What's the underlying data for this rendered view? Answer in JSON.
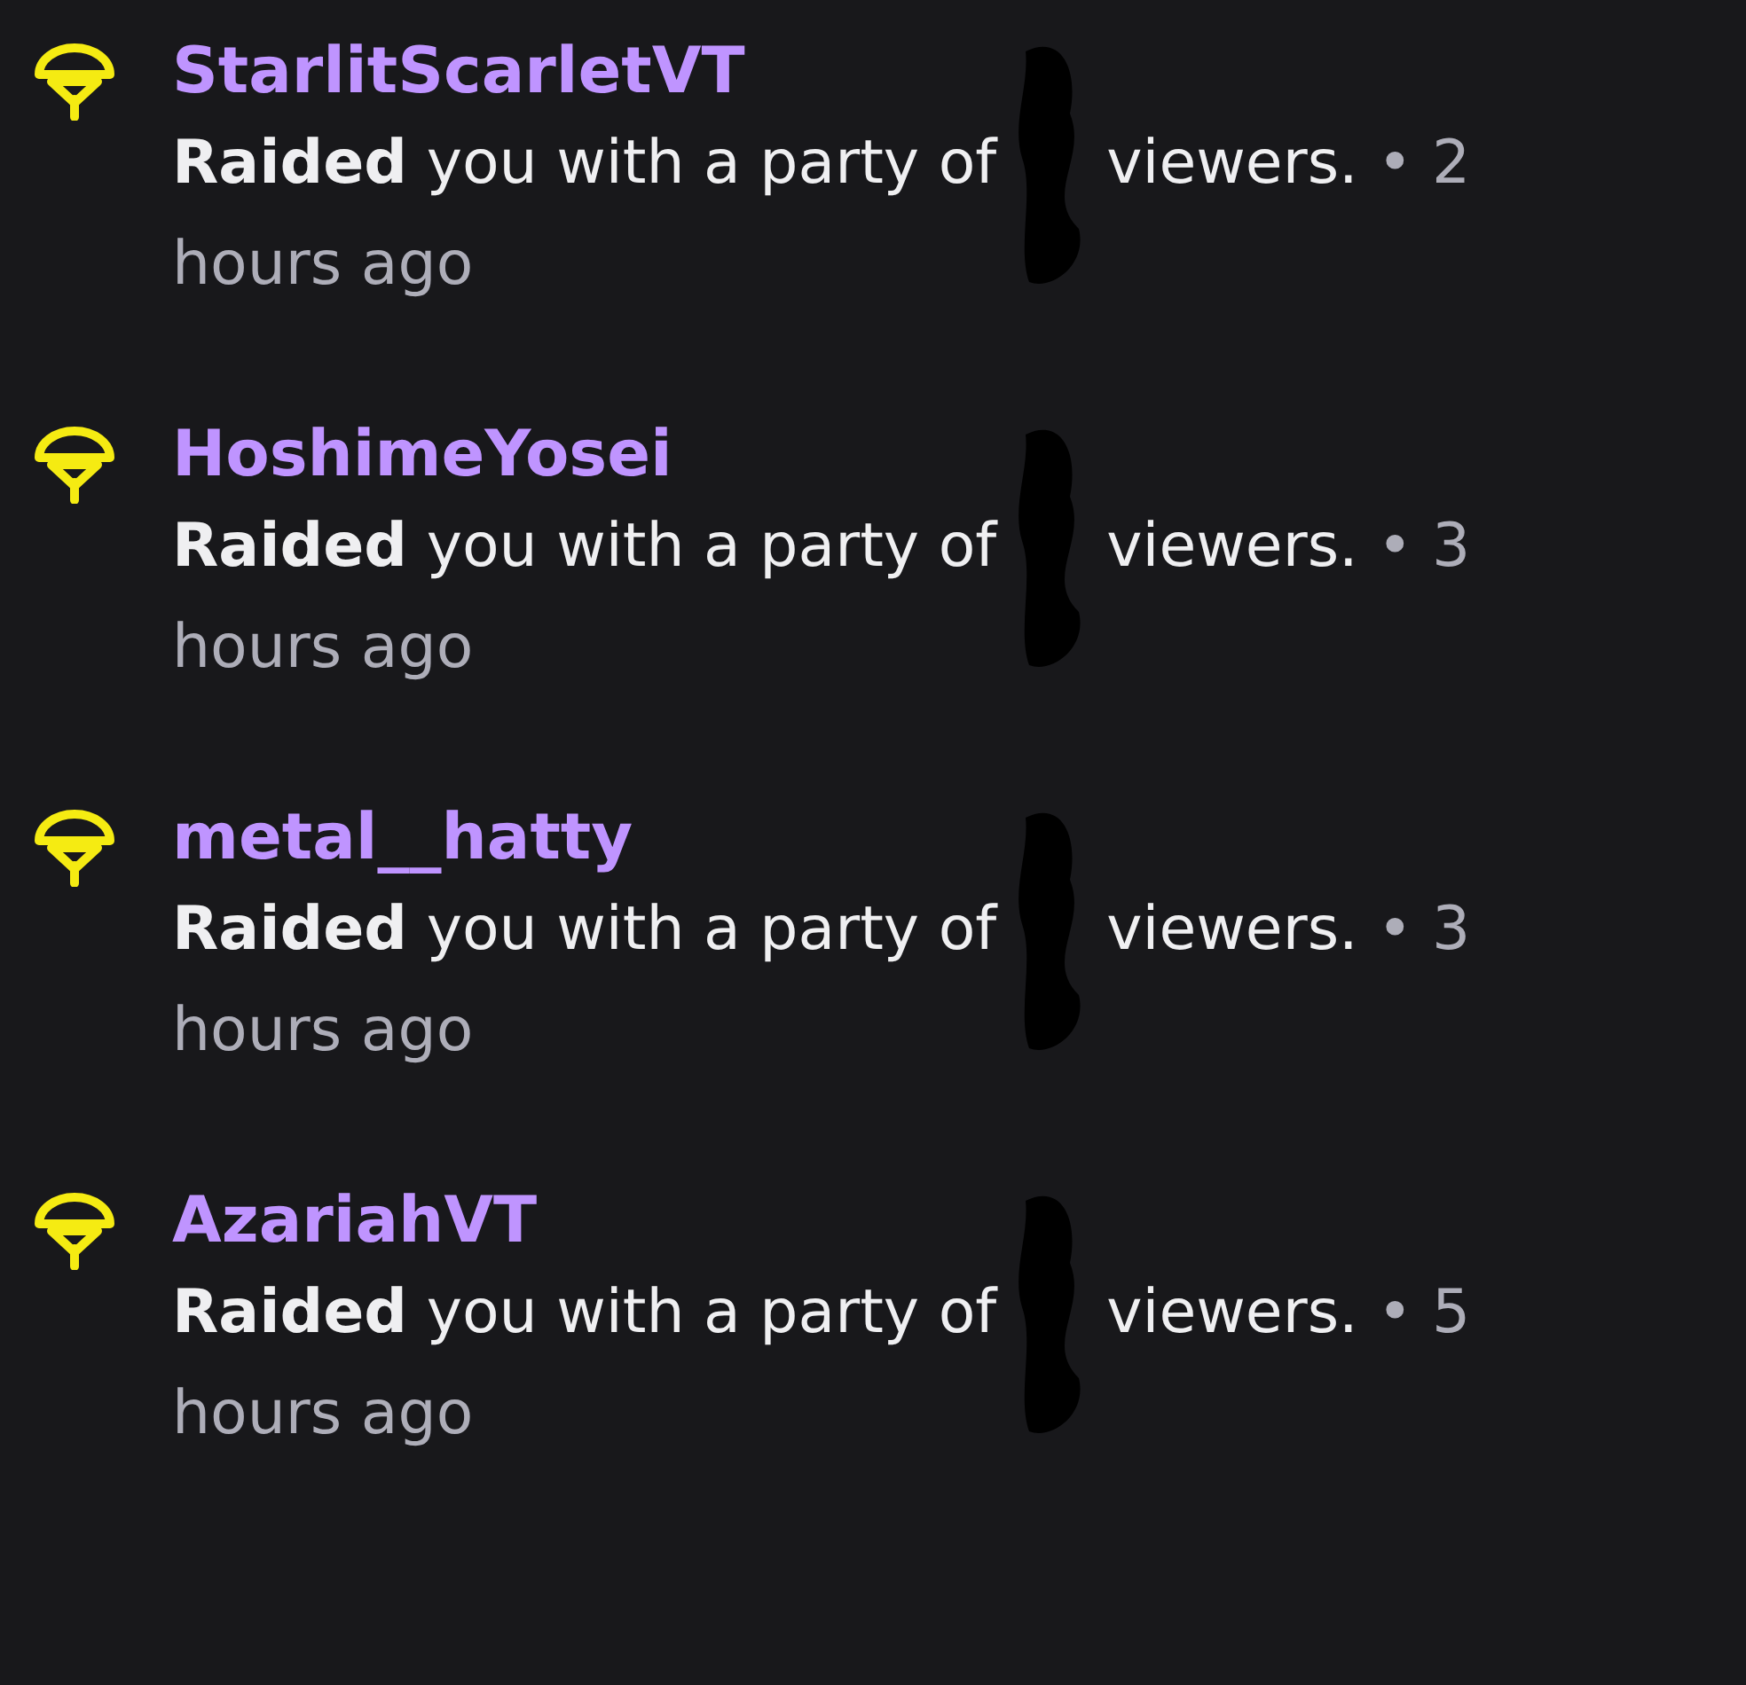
{
  "activity_feed": [
    {
      "user": "StarlitScarletVT",
      "message_before": "**Raided** you with a party of",
      "message_after": "viewers.",
      "time": "• 2",
      "time_line_2": "hours ago"
    },
    {
      "user": "HoshimeYosei",
      "message_before": "**Raided** you with a party of",
      "message_after": "viewers.",
      "time": "• 3",
      "time_line_2": "hours ago"
    },
    {
      "user": "metal__hatty",
      "message_before": "**Raided** you with a party of",
      "message_after": "viewers.",
      "time": "• 3",
      "time_line_2": "hours ago"
    },
    {
      "user": "AzariahVT",
      "message_before": "**Raided** you with a party of",
      "message_after": "viewers.",
      "time": "• 5",
      "time_line_2": "hours ago"
    }
  ]
}
